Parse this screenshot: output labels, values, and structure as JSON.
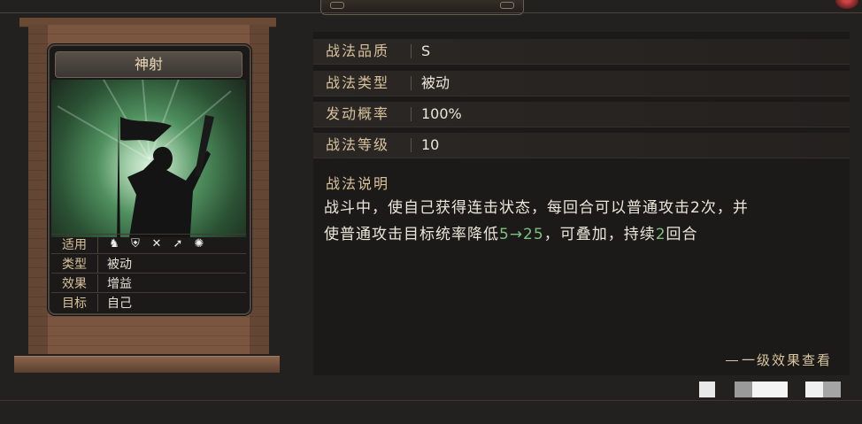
{
  "card": {
    "name": "神射",
    "rows": [
      {
        "label": "适用",
        "value": ""
      },
      {
        "label": "类型",
        "value": "被动"
      },
      {
        "label": "效果",
        "value": "增益"
      },
      {
        "label": "目标",
        "value": "自己"
      }
    ],
    "applicable_icons": [
      "cavalry-icon",
      "shield-icon",
      "crossbow-icon",
      "spear-icon",
      "wheel-icon"
    ]
  },
  "attributes": [
    {
      "key": "战法品质",
      "value": "S"
    },
    {
      "key": "战法类型",
      "value": "被动"
    },
    {
      "key": "发动概率",
      "value": "100%"
    },
    {
      "key": "战法等级",
      "value": "10"
    }
  ],
  "description": {
    "title": "战法说明",
    "line1": "战斗中，使自己获得连击状态，每回合可以普通攻击2次，并",
    "line2_pre": "使普通攻击目标统率降低",
    "line2_g1": "5→25",
    "line2_mid": "，可叠加，持续",
    "line2_g2": "2",
    "line2_post": "回合"
  },
  "link": {
    "label": "一级效果查看"
  },
  "colors": {
    "accent_gold": "#d7c29c",
    "highlight_green": "#7fbf7f",
    "text": "#ece6da"
  }
}
